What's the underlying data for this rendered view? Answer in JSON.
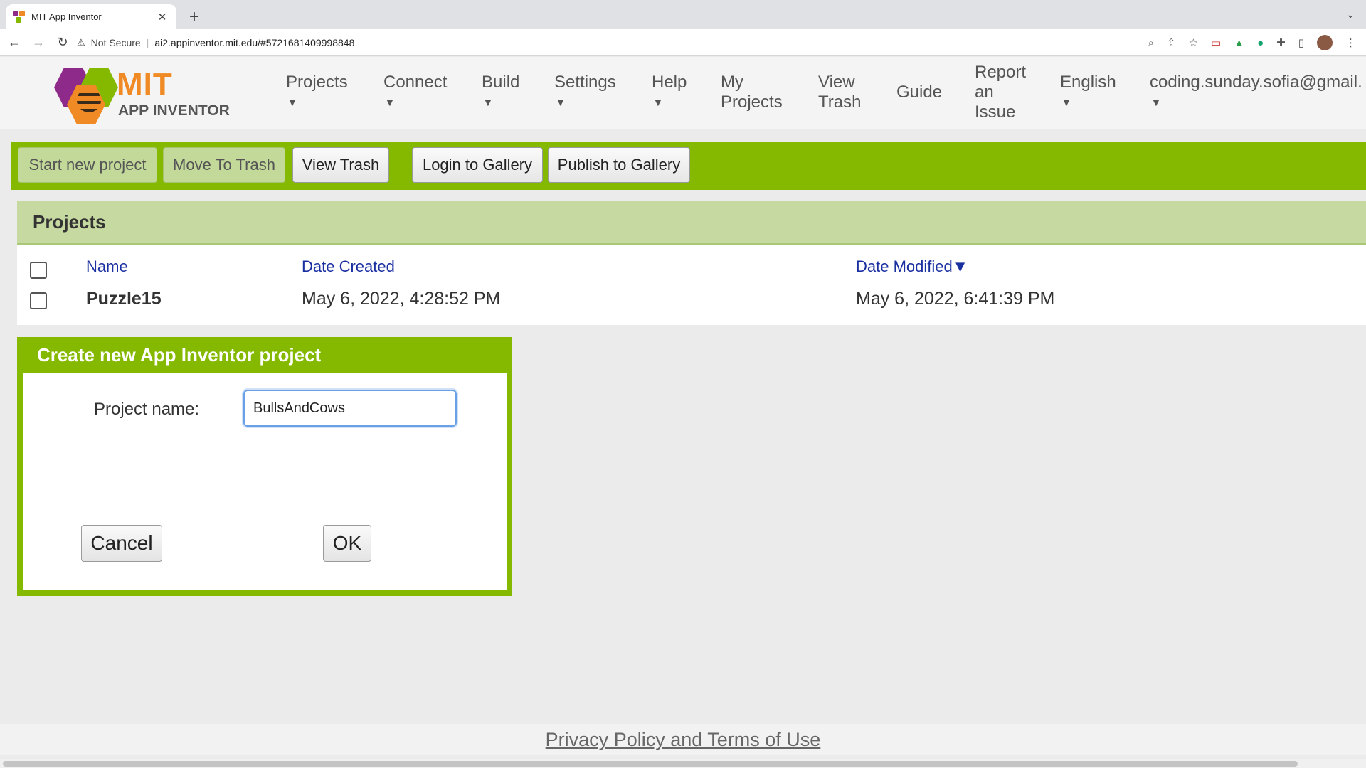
{
  "browser": {
    "tab_title": "MIT App Inventor",
    "security_label": "Not Secure",
    "url": "ai2.appinventor.mit.edu/#5721681409998848"
  },
  "logo": {
    "title": "MIT",
    "subtitle": "APP INVENTOR"
  },
  "menu": {
    "projects": "Projects",
    "connect": "Connect",
    "build": "Build",
    "settings": "Settings",
    "help": "Help",
    "my_projects_1": "My",
    "my_projects_2": "Projects",
    "view_trash_1": "View",
    "view_trash_2": "Trash",
    "guide": "Guide",
    "report_1": "Report",
    "report_2": "an",
    "report_3": "Issue",
    "language": "English",
    "account": "coding.sunday.sofia@gmail."
  },
  "actions": {
    "start_new": "Start new project",
    "move_to_trash": "Move To Trash",
    "view_trash": "View Trash",
    "login_gallery": "Login to Gallery",
    "publish_gallery": "Publish to Gallery"
  },
  "projects": {
    "heading": "Projects",
    "columns": {
      "name": "Name",
      "created": "Date Created",
      "modified": "Date Modified▼"
    },
    "rows": [
      {
        "name": "Puzzle15",
        "created": "May 6, 2022, 4:28:52 PM",
        "modified": "May 6, 2022, 6:41:39 PM"
      }
    ]
  },
  "dialog": {
    "title": "Create new App Inventor project",
    "label": "Project name:",
    "value": "BullsAndCows",
    "cancel": "Cancel",
    "ok": "OK"
  },
  "footer": {
    "link": "Privacy Policy and Terms of Use"
  },
  "colors": {
    "accent_green": "#85b900",
    "link_blue": "#1a2fa0",
    "logo_orange": "#f08a24"
  }
}
